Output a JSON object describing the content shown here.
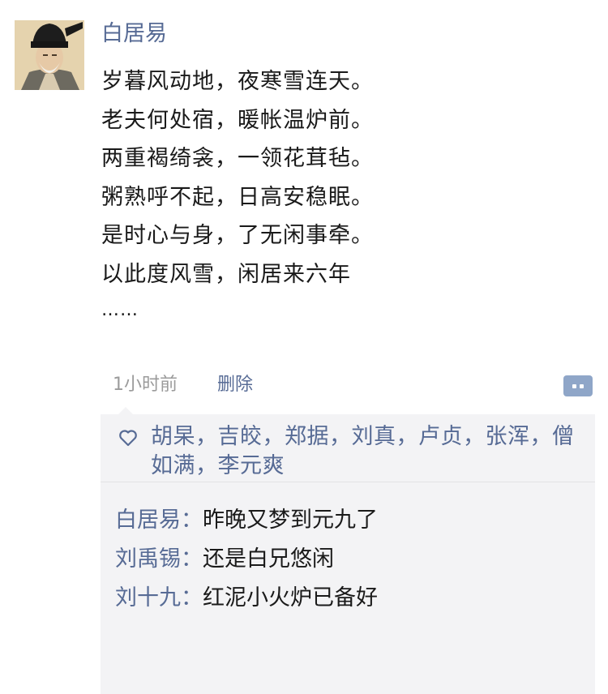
{
  "post": {
    "author": "白居易",
    "poem_lines": [
      "岁暮风动地，夜寒雪连天。",
      "老夫何处宿，暖帐温炉前。",
      "两重褐绮衾，一领花茸毡。",
      "粥熟呼不起，日高安稳眠。",
      "是时心与身，了无闲事牵。",
      "以此度风雪，闲居来六年"
    ],
    "ellipsis": "……",
    "time": "1小时前",
    "delete_label": "删除"
  },
  "likes": {
    "names": "胡杲，吉皎，郑据，刘真，卢贞，张浑，僧如满，李元爽"
  },
  "comments": [
    {
      "author": "白居易",
      "colon": "：",
      "text": "昨晚又梦到元九了"
    },
    {
      "author": "刘禹锡",
      "colon": "：",
      "text": "还是白兄悠闲"
    },
    {
      "author": "刘十九",
      "colon": "：",
      "text": "红泥小火炉已备好"
    }
  ],
  "colors": {
    "link": "#576b95",
    "text": "#1a1a1a",
    "meta": "#9b9b9b",
    "comment_bg": "#f3f3f5"
  },
  "icons": {
    "avatar": "portrait-avatar",
    "more": "more-dots-icon",
    "like": "heart-outline-icon"
  }
}
